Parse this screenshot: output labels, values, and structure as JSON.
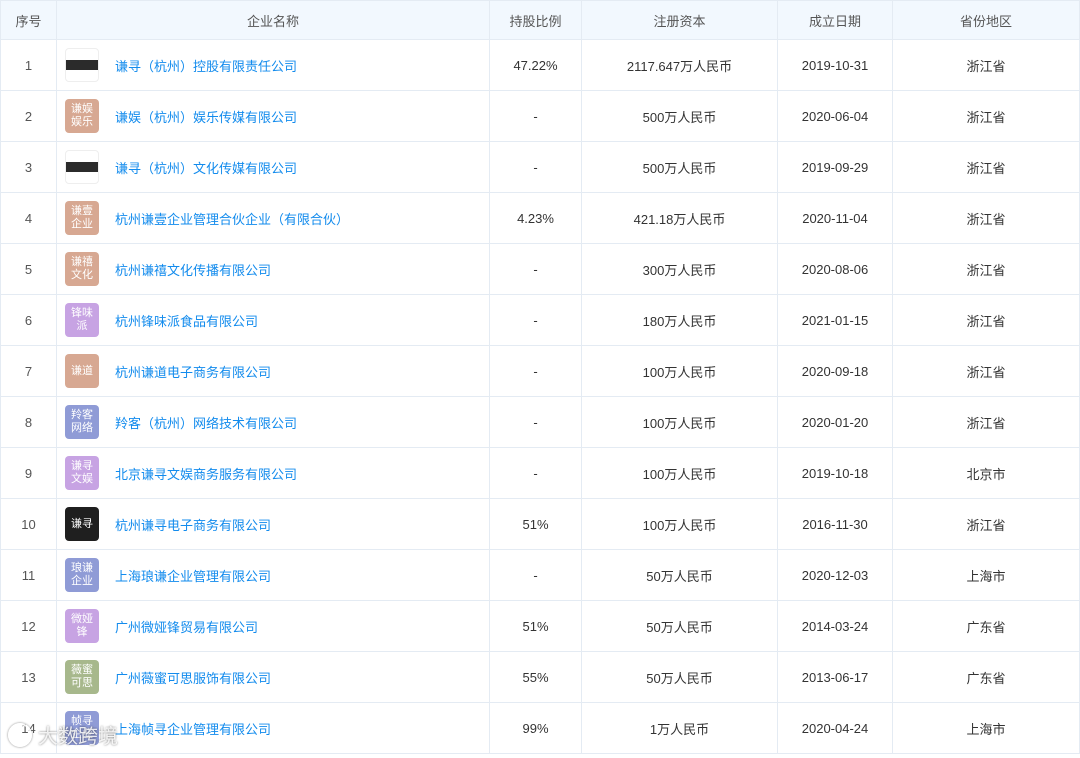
{
  "table": {
    "headers": {
      "index": "序号",
      "company": "企业名称",
      "share": "持股比例",
      "capital": "注册资本",
      "date": "成立日期",
      "region": "省份地区"
    },
    "rows": [
      {
        "index": "1",
        "logo": {
          "type": "strip",
          "text": "MINE"
        },
        "name": "谦寻（杭州）控股有限责任公司",
        "share": "47.22%",
        "capital": "2117.647万人民币",
        "date": "2019-10-31",
        "region": "浙江省"
      },
      {
        "index": "2",
        "logo": {
          "type": "text",
          "text": "谦娱娱乐",
          "color": "#d7a892"
        },
        "name": "谦娱（杭州）娱乐传媒有限公司",
        "share": "-",
        "capital": "500万人民币",
        "date": "2020-06-04",
        "region": "浙江省"
      },
      {
        "index": "3",
        "logo": {
          "type": "strip",
          "text": "MINE"
        },
        "name": "谦寻（杭州）文化传媒有限公司",
        "share": "-",
        "capital": "500万人民币",
        "date": "2019-09-29",
        "region": "浙江省"
      },
      {
        "index": "4",
        "logo": {
          "type": "text",
          "text": "谦壹企业",
          "color": "#d7a892"
        },
        "name": "杭州谦壹企业管理合伙企业（有限合伙）",
        "share": "4.23%",
        "capital": "421.18万人民币",
        "date": "2020-11-04",
        "region": "浙江省"
      },
      {
        "index": "5",
        "logo": {
          "type": "text",
          "text": "谦禧文化",
          "color": "#d7a892"
        },
        "name": "杭州谦禧文化传播有限公司",
        "share": "-",
        "capital": "300万人民币",
        "date": "2020-08-06",
        "region": "浙江省"
      },
      {
        "index": "6",
        "logo": {
          "type": "text",
          "text": "锋味派",
          "color": "#c7a3e3"
        },
        "name": "杭州锋味派食品有限公司",
        "share": "-",
        "capital": "180万人民币",
        "date": "2021-01-15",
        "region": "浙江省"
      },
      {
        "index": "7",
        "logo": {
          "type": "text",
          "text": "谦道",
          "color": "#d7a892"
        },
        "name": "杭州谦道电子商务有限公司",
        "share": "-",
        "capital": "100万人民币",
        "date": "2020-09-18",
        "region": "浙江省"
      },
      {
        "index": "8",
        "logo": {
          "type": "text",
          "text": "羚客网络",
          "color": "#8f9bd6"
        },
        "name": "羚客（杭州）网络技术有限公司",
        "share": "-",
        "capital": "100万人民币",
        "date": "2020-01-20",
        "region": "浙江省"
      },
      {
        "index": "9",
        "logo": {
          "type": "text",
          "text": "谦寻文娱",
          "color": "#c7a3e3"
        },
        "name": "北京谦寻文娱商务服务有限公司",
        "share": "-",
        "capital": "100万人民币",
        "date": "2019-10-18",
        "region": "北京市"
      },
      {
        "index": "10",
        "logo": {
          "type": "dark",
          "text": "谦寻"
        },
        "name": "杭州谦寻电子商务有限公司",
        "share": "51%",
        "capital": "100万人民币",
        "date": "2016-11-30",
        "region": "浙江省"
      },
      {
        "index": "11",
        "logo": {
          "type": "text",
          "text": "琅谦企业",
          "color": "#8f9bd6"
        },
        "name": "上海琅谦企业管理有限公司",
        "share": "-",
        "capital": "50万人民币",
        "date": "2020-12-03",
        "region": "上海市"
      },
      {
        "index": "12",
        "logo": {
          "type": "text",
          "text": "微娅锋",
          "color": "#c7a3e3"
        },
        "name": "广州微娅锋贸易有限公司",
        "share": "51%",
        "capital": "50万人民币",
        "date": "2014-03-24",
        "region": "广东省"
      },
      {
        "index": "13",
        "logo": {
          "type": "text",
          "text": "薇蜜可思",
          "color": "#a7b88c"
        },
        "name": "广州薇蜜可思服饰有限公司",
        "share": "55%",
        "capital": "50万人民币",
        "date": "2013-06-17",
        "region": "广东省"
      },
      {
        "index": "14",
        "logo": {
          "type": "text",
          "text": "帧寻企业",
          "color": "#8f9bd6"
        },
        "name": "上海帧寻企业管理有限公司",
        "share": "99%",
        "capital": "1万人民币",
        "date": "2020-04-24",
        "region": "上海市"
      }
    ]
  },
  "watermark": {
    "text": "大数跨境"
  },
  "colors": {
    "link": "#128bed",
    "header_bg": "#f2f8fe",
    "border": "#e4ebf3"
  }
}
